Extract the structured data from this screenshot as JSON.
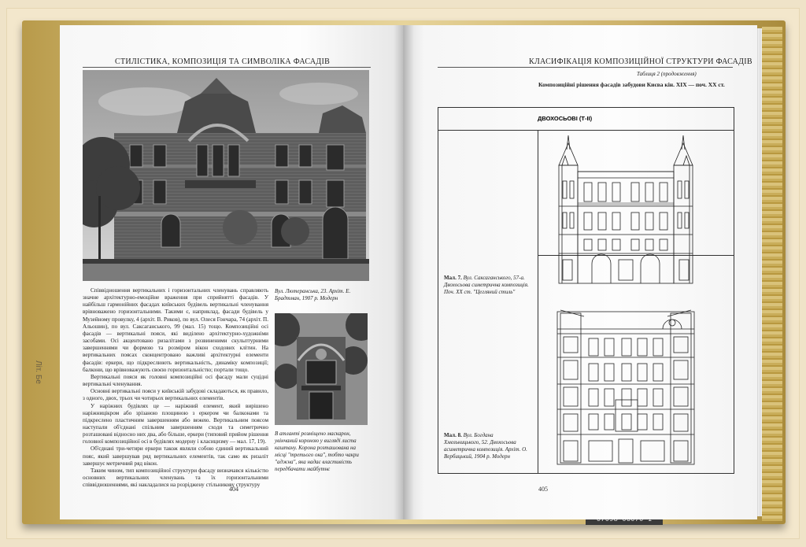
{
  "left_page": {
    "running_head": "СТИЛІСТИКА, КОМПОЗИЦІЯ ТА СИМВОЛІКА ФАСАДІВ",
    "body_paragraphs": [
      "Співвідношення вертикальних і горизонтальних членувань справляють значне архітектурно-емоційне враження при сприйнятті фасадів. У найбільш гармонійних фасадах київських будівель вертикальні членування врівноважено горизонтальними. Такими є, наприклад, фасади будівель у Музейному провулку, 4 (архіт. В. Риков), по вул. Олеся Гончара, 74 (архіт. П. Альошин), по вул. Саксаганського, 99 (мал. 15) тощо. Композиційні осі фасадів — вертикальні пояси, які виділено архітектурно-художніми засобами. Осі акцентовано ризалітами з розвиненими скульптурними завершеннями чи формою та розміром вікон сходових клітин. На вертикальних поясах сконцентровано важливі архітектурні елементи фасадів: еркери, що підкреслюють вертикальність, динаміку композиції; балкони, що врівноважують своєю горизонтальністю; портали тощо.",
      "Вертикальні пояси як головні композиційні осі фасаду мали суцідні вертикальні членування.",
      "Основні вертикальні пояси у київській забудові складаються, як правило, з одного, двох, трьох чи чотирьох вертикальних елементів.",
      "У наріжних будівлях це — наріжний елемент, який вирішено наріжницікром або зрізаною площиною з еркером чи балконами та підкреслено пластичним завершенням або вежею. Вертикальним поясом наступали об'єднані спільним завершенням сходи та симетрично розташовані відносно них два, або більше, еркери (типовий прийом рішення головної композиційної осі в будівлях модерну і класицизму — мал. 17, 19).",
      "Об'єднані три-четири еркери також являли собою єдиний вертикальний пояс, який завершував ряд вертикальних елементів, так само як ризаліт завершує метричний ряд вікон.",
      "Таким чином, тип композиційної структури фасаду визначався кількістю основних вертикальних членувань та їх горизонтальними співвідношеннями, які накладалися на розріджену стільникову структуру"
    ],
    "caption_top": "Вул. Лютеранська, 23. Архіт. Е. Брадтман, 1907 р. Модерн",
    "caption_bottom": "В атланті розміщено маскарон, увінчаний короною у вигляді листа каштану. Корона розташована на місці \"третього ока\", тобто чакри \"аджна\", яка надає властивість передбачати майбутнє",
    "folio": "404"
  },
  "right_page": {
    "running_head": "КЛАСИФІКАЦІЯ КОМПОЗИЦІЙНОЇ СТРУКТУРИ ФАСАДІВ",
    "table_label": "Таблиця 2 (продовження)",
    "table_title": "Композиційні рішення фасадів забудови Києва кін. XIX — поч. XX ст.",
    "table_header": "ДВОХОСЬОВІ (Т-II)",
    "row1_caption_lead": "Мал. 7.",
    "row1_caption": "Вул. Саксаганського, 57-а. Двохосьова симетрична композиція. Поч. XX ст. \"Цегляний стиль\"",
    "row2_caption_lead": "Мал. 8.",
    "row2_caption": "Вул. Богдана Хмельницького, 52. Двохосьова асиметрична композиція. Архіт. О. Вербицький, 1904 р. Модерн",
    "folio": "405"
  },
  "background": {
    "spine_text": "Літ. Бе",
    "sticker_text": "07098 06070 1"
  },
  "colors": {
    "cover": "#d5bf7a",
    "paper": "#fbfbfb",
    "ink": "#222222"
  }
}
